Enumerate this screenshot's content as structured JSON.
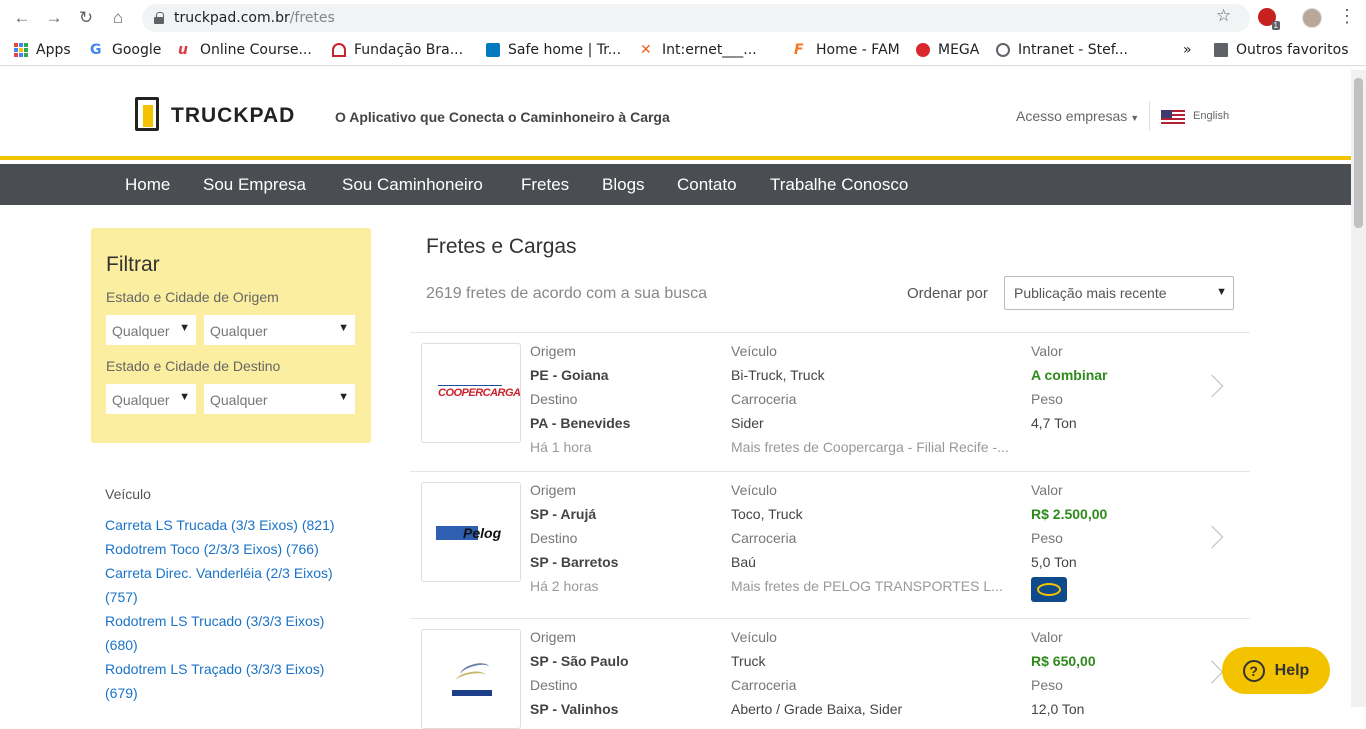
{
  "browser": {
    "url_domain": "truckpad.com.br",
    "url_path": "/fretes",
    "extension_badge": "1",
    "bookmarks": [
      {
        "label": "Apps"
      },
      {
        "label": "Google"
      },
      {
        "label": "Online Course..."
      },
      {
        "label": "Fundação Bra..."
      },
      {
        "label": "Safe home | Tr..."
      },
      {
        "label": "Int:ernet___..."
      },
      {
        "label": "Home - FAM"
      },
      {
        "label": "MEGA"
      },
      {
        "label": "Intranet - Stef..."
      }
    ],
    "more_bookmarks": "»",
    "other_favorites": "Outros favoritos"
  },
  "header": {
    "logo_text": "TRUCKPAD",
    "tagline": "O Aplicativo que Conecta o Caminhoneiro à Carga",
    "acesso": "Acesso empresas",
    "language": "English"
  },
  "nav": [
    "Home",
    "Sou Empresa",
    "Sou Caminhoneiro",
    "Fretes",
    "Blogs",
    "Contato",
    "Trabalhe Conosco"
  ],
  "filter": {
    "title": "Filtrar",
    "origin_label": "Estado e Cidade de Origem",
    "dest_label": "Estado e Cidade de Destino",
    "state_value": "Qualquer",
    "city_value": "Qualquer"
  },
  "vehicles": {
    "title": "Veículo",
    "items": [
      " Carreta LS Trucada (3/3 Eixos) (821)",
      " Rodotrem Toco (2/3/3 Eixos) (766)",
      " Carreta Direc. Vanderléia (2/3 Eixos) (757)",
      " Rodotrem LS Trucado (3/3/3 Eixos) (680)",
      " Rodotrem LS Traçado (3/3/3 Eixos) (679)"
    ]
  },
  "content": {
    "title": "Fretes e Cargas",
    "count": "2619 fretes de acordo com a sua busca",
    "order_label": "Ordenar por",
    "order_value": "Publicação mais recente"
  },
  "labels": {
    "origem": "Origem",
    "destino": "Destino",
    "veiculo": "Veículo",
    "carroceria": "Carroceria",
    "valor": "Valor",
    "peso": "Peso"
  },
  "cards": [
    {
      "company_logo": "COOPERCARGA",
      "origin": "PE - Goiana",
      "destination": "PA - Benevides",
      "time": "Há 1 hora",
      "vehicle": "Bi-Truck, Truck",
      "body": "Sider",
      "more": "Mais fretes de Coopercarga - Filial Recife -...",
      "value": "A combinar",
      "weight": "4,7 Ton"
    },
    {
      "company_logo": "Pelog",
      "origin": "SP - Arujá",
      "destination": "SP - Barretos",
      "time": "Há 2 horas",
      "vehicle": "Toco, Truck",
      "body": "Baú",
      "more": "Mais fretes de PELOG TRANSPORTES L...",
      "value": "R$ 2.500,00",
      "weight": "5,0 Ton"
    },
    {
      "company_logo": "",
      "origin": "SP - São Paulo",
      "destination": "SP - Valinhos",
      "time": "",
      "vehicle": "Truck",
      "body": "Aberto / Grade Baixa, Sider",
      "more": "",
      "value": "R$ 650,00",
      "weight": "12,0 Ton"
    }
  ],
  "help": "Help"
}
